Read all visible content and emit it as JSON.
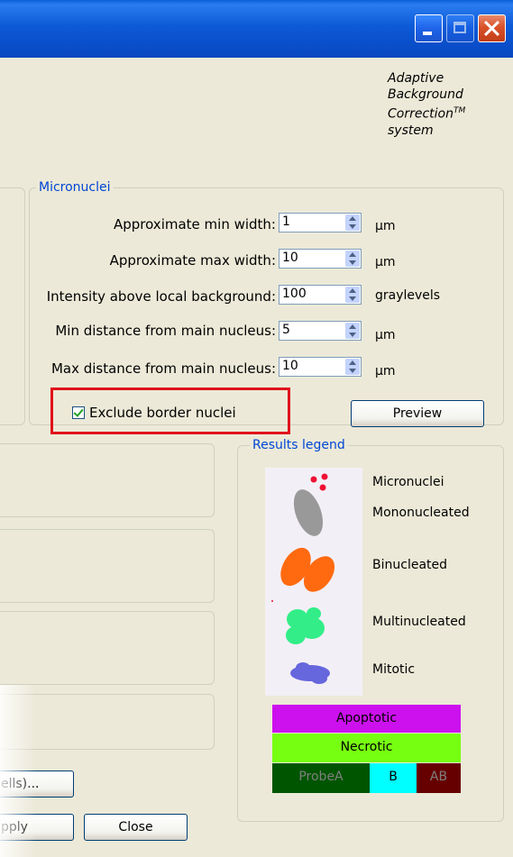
{
  "window": {
    "controls": {
      "minimize": "minimize",
      "maximize": "maximize",
      "close": "close"
    }
  },
  "abc": {
    "line1": "Adaptive",
    "line2": "Background",
    "line3": "Correction",
    "tm": "TM",
    "line4": "system"
  },
  "micronuclei": {
    "title": "Micronuclei",
    "rows": [
      {
        "label": "Approximate min width:",
        "value": "1",
        "unit": "µm"
      },
      {
        "label": "Approximate max width:",
        "value": "10",
        "unit": "µm"
      },
      {
        "label": "Intensity above local background:",
        "value": "100",
        "unit": "graylevels"
      },
      {
        "label": "Min distance from main nucleus:",
        "value": "5",
        "unit": "µm"
      },
      {
        "label": "Max distance from main nucleus:",
        "value": "10",
        "unit": "µm"
      }
    ],
    "exclude_border_label": "Exclude border nuclei",
    "exclude_border_checked": true,
    "preview_label": "Preview"
  },
  "results_legend": {
    "title": "Results legend",
    "items": [
      "Micronuclei",
      "Mononucleated",
      "Binucleated",
      "Multinucleated",
      "Mitotic"
    ],
    "apoptotic": "Apoptotic",
    "necrotic": "Necrotic",
    "probeA": "ProbeA",
    "b": "B",
    "ab": "AB",
    "colors": {
      "apoptotic": "#cc11ee",
      "necrotic": "#77ff11",
      "probeA": "#005500",
      "b": "#00ffff",
      "ab": "#660000",
      "micronuclei": "#ee1133",
      "mononucleated": "#999999",
      "binucleated": "#ff6a10",
      "multinucleated": "#33ee88",
      "mitotic": "#6666dd"
    }
  },
  "bottom_buttons": {
    "cells": "ells)...",
    "apply": "pply",
    "close": "Close"
  }
}
